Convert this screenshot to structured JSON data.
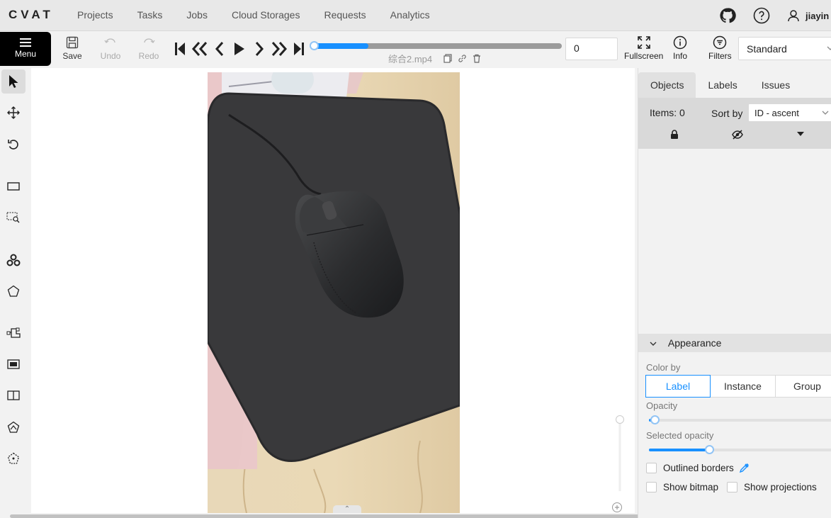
{
  "header": {
    "logo": "CVAT",
    "nav": [
      "Projects",
      "Tasks",
      "Jobs",
      "Cloud Storages",
      "Requests",
      "Analytics"
    ],
    "username": "jiayin"
  },
  "toolbar": {
    "menu_label": "Menu",
    "save_label": "Save",
    "undo_label": "Undo",
    "redo_label": "Redo",
    "filename": "综合2.mp4",
    "frame_value": "0",
    "progress": 0.22,
    "fullscreen_label": "Fullscreen",
    "info_label": "Info",
    "filters_label": "Filters",
    "workspace_value": "Standard"
  },
  "sidebar": {
    "tabs": [
      "Objects",
      "Labels",
      "Issues"
    ],
    "items_label": "Items: 0",
    "sort_label": "Sort by",
    "sort_value": "ID - ascent",
    "appearance_title": "Appearance",
    "color_by_label": "Color by",
    "color_by_options": [
      "Label",
      "Instance",
      "Group"
    ],
    "color_by_selected": "Label",
    "opacity_label": "Opacity",
    "opacity_value": 0.03,
    "selected_opacity_label": "Selected opacity",
    "selected_opacity_value": 0.33,
    "outlined_borders_label": "Outlined borders",
    "show_bitmap_label": "Show bitmap",
    "show_projections_label": "Show projections"
  },
  "colors": {
    "accent": "#1890ff",
    "menu_bg": "#000000"
  }
}
